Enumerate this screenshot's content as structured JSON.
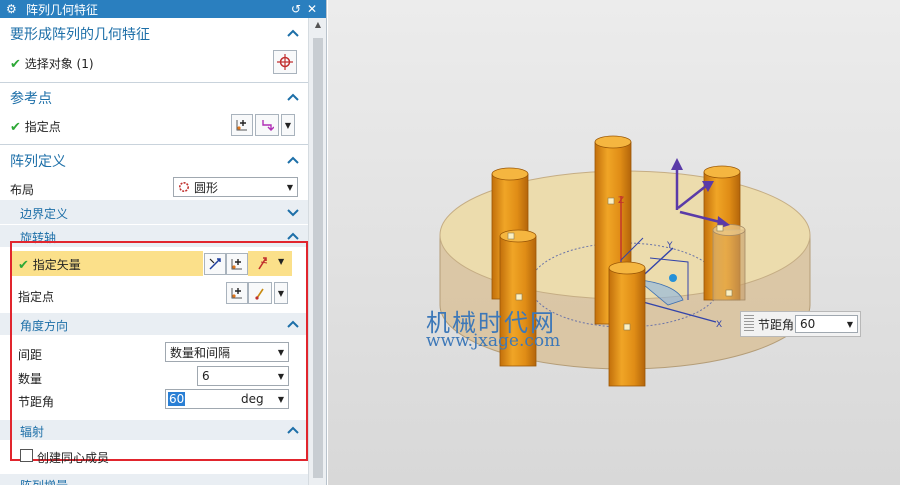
{
  "dialog": {
    "title": "阵列几何特征",
    "section_geometry": {
      "title": "要形成阵列的几何特征",
      "select_object": "选择对象 (1)"
    },
    "section_reference_point": {
      "title": "参考点",
      "specify_point": "指定点"
    },
    "section_array_definition": {
      "title": "阵列定义",
      "layout_label": "布局",
      "layout_value": "圆形",
      "boundary_definition": "边界定义",
      "rotation_axis": {
        "title": "旋转轴",
        "specify_vector": "指定矢量",
        "specify_point": "指定点"
      },
      "angle_direction": {
        "title": "角度方向",
        "spacing_label": "间距",
        "spacing_value": "数量和间隔",
        "count_label": "数量",
        "count_value": "6",
        "pitch_label": "节距角",
        "pitch_value": "60",
        "pitch_unit": "deg"
      },
      "radiate": {
        "title": "辐射",
        "create_concentric": "创建同心成员",
        "checked": false
      },
      "next_section_partial": "阵列增量"
    }
  },
  "viewport": {
    "watermark_cn": "机械时代网",
    "watermark_url": "www.jxage.com",
    "pitch_handle_label": "节距角",
    "pitch_handle_value": "60",
    "axis_labels": {
      "x": "X",
      "y": "Y",
      "z": "Z"
    }
  },
  "colors": {
    "title_bar": "#2a7fbf",
    "section_title": "#1d6fa8",
    "highlight_row": "#fbe08a",
    "red_box": "#e1252d",
    "cylinder": "#e8961a",
    "disk_top": "#ecdcad"
  },
  "icons": {
    "titlebar": "gear-icon",
    "reset": "reset-icon",
    "close": "close-icon",
    "collapse": "chevron-up-icon",
    "expand": "chevron-down-icon",
    "select_object": "crosshair-icon",
    "point_dialog": "point-icon",
    "snap": "snap-point-icon",
    "vector": "vector-icon",
    "layout": "circle-layout-icon"
  }
}
